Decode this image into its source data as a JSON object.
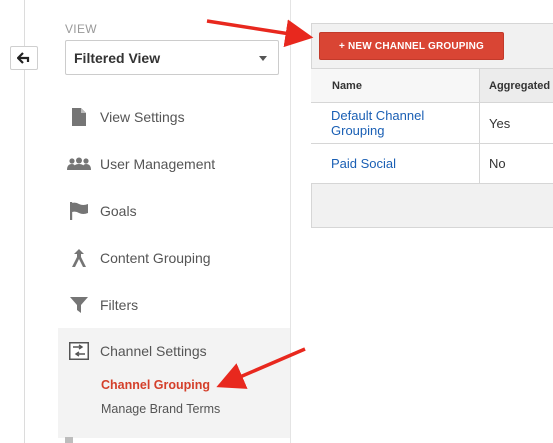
{
  "view": {
    "section_label": "VIEW",
    "selected": "Filtered View"
  },
  "sidebar": {
    "back_icon": "arrow-left-icon",
    "items": [
      {
        "label": "View Settings",
        "icon": "document-icon"
      },
      {
        "label": "User Management",
        "icon": "users-icon"
      },
      {
        "label": "Goals",
        "icon": "flag-icon"
      },
      {
        "label": "Content Grouping",
        "icon": "content-grouping-icon"
      },
      {
        "label": "Filters",
        "icon": "filter-icon"
      }
    ],
    "channel_settings": {
      "label": "Channel Settings",
      "icon": "channel-settings-icon",
      "subitems": [
        {
          "label": "Channel Grouping",
          "active": true
        },
        {
          "label": "Manage Brand Terms",
          "active": false
        }
      ]
    }
  },
  "main": {
    "new_button_label": "+ NEW CHANNEL GROUPING",
    "table": {
      "columns": [
        "Name",
        "Aggregated"
      ],
      "rows": [
        {
          "name": "Default Channel Grouping",
          "aggregated": "Yes"
        },
        {
          "name": "Paid Social",
          "aggregated": "No"
        }
      ]
    }
  },
  "colors": {
    "accent_red": "#d94534",
    "active_link": "#d43f2a",
    "link_blue": "#1a5fb4",
    "annotation_arrow": "#e8281e"
  }
}
